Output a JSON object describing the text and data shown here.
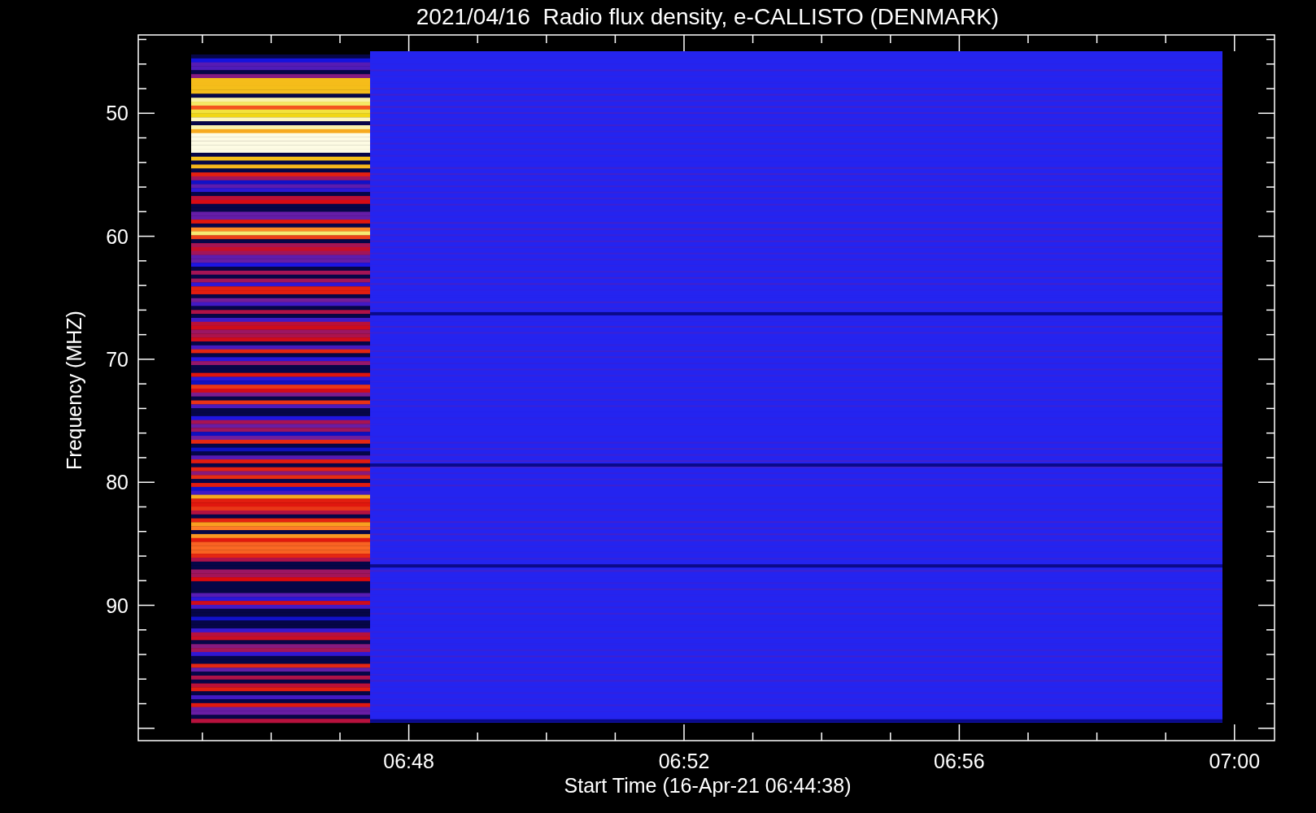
{
  "title": "2021/04/16  Radio flux density, e-CALLISTO (DENMARK)",
  "y_axis": {
    "label": "Frequency (MHZ)",
    "ticks": [
      "50",
      "60",
      "70",
      "80",
      "90"
    ]
  },
  "x_axis": {
    "label": "Start Time (16-Apr-21 06:44:38)",
    "ticks": [
      "06:48",
      "06:52",
      "06:56",
      "07:00"
    ]
  }
}
